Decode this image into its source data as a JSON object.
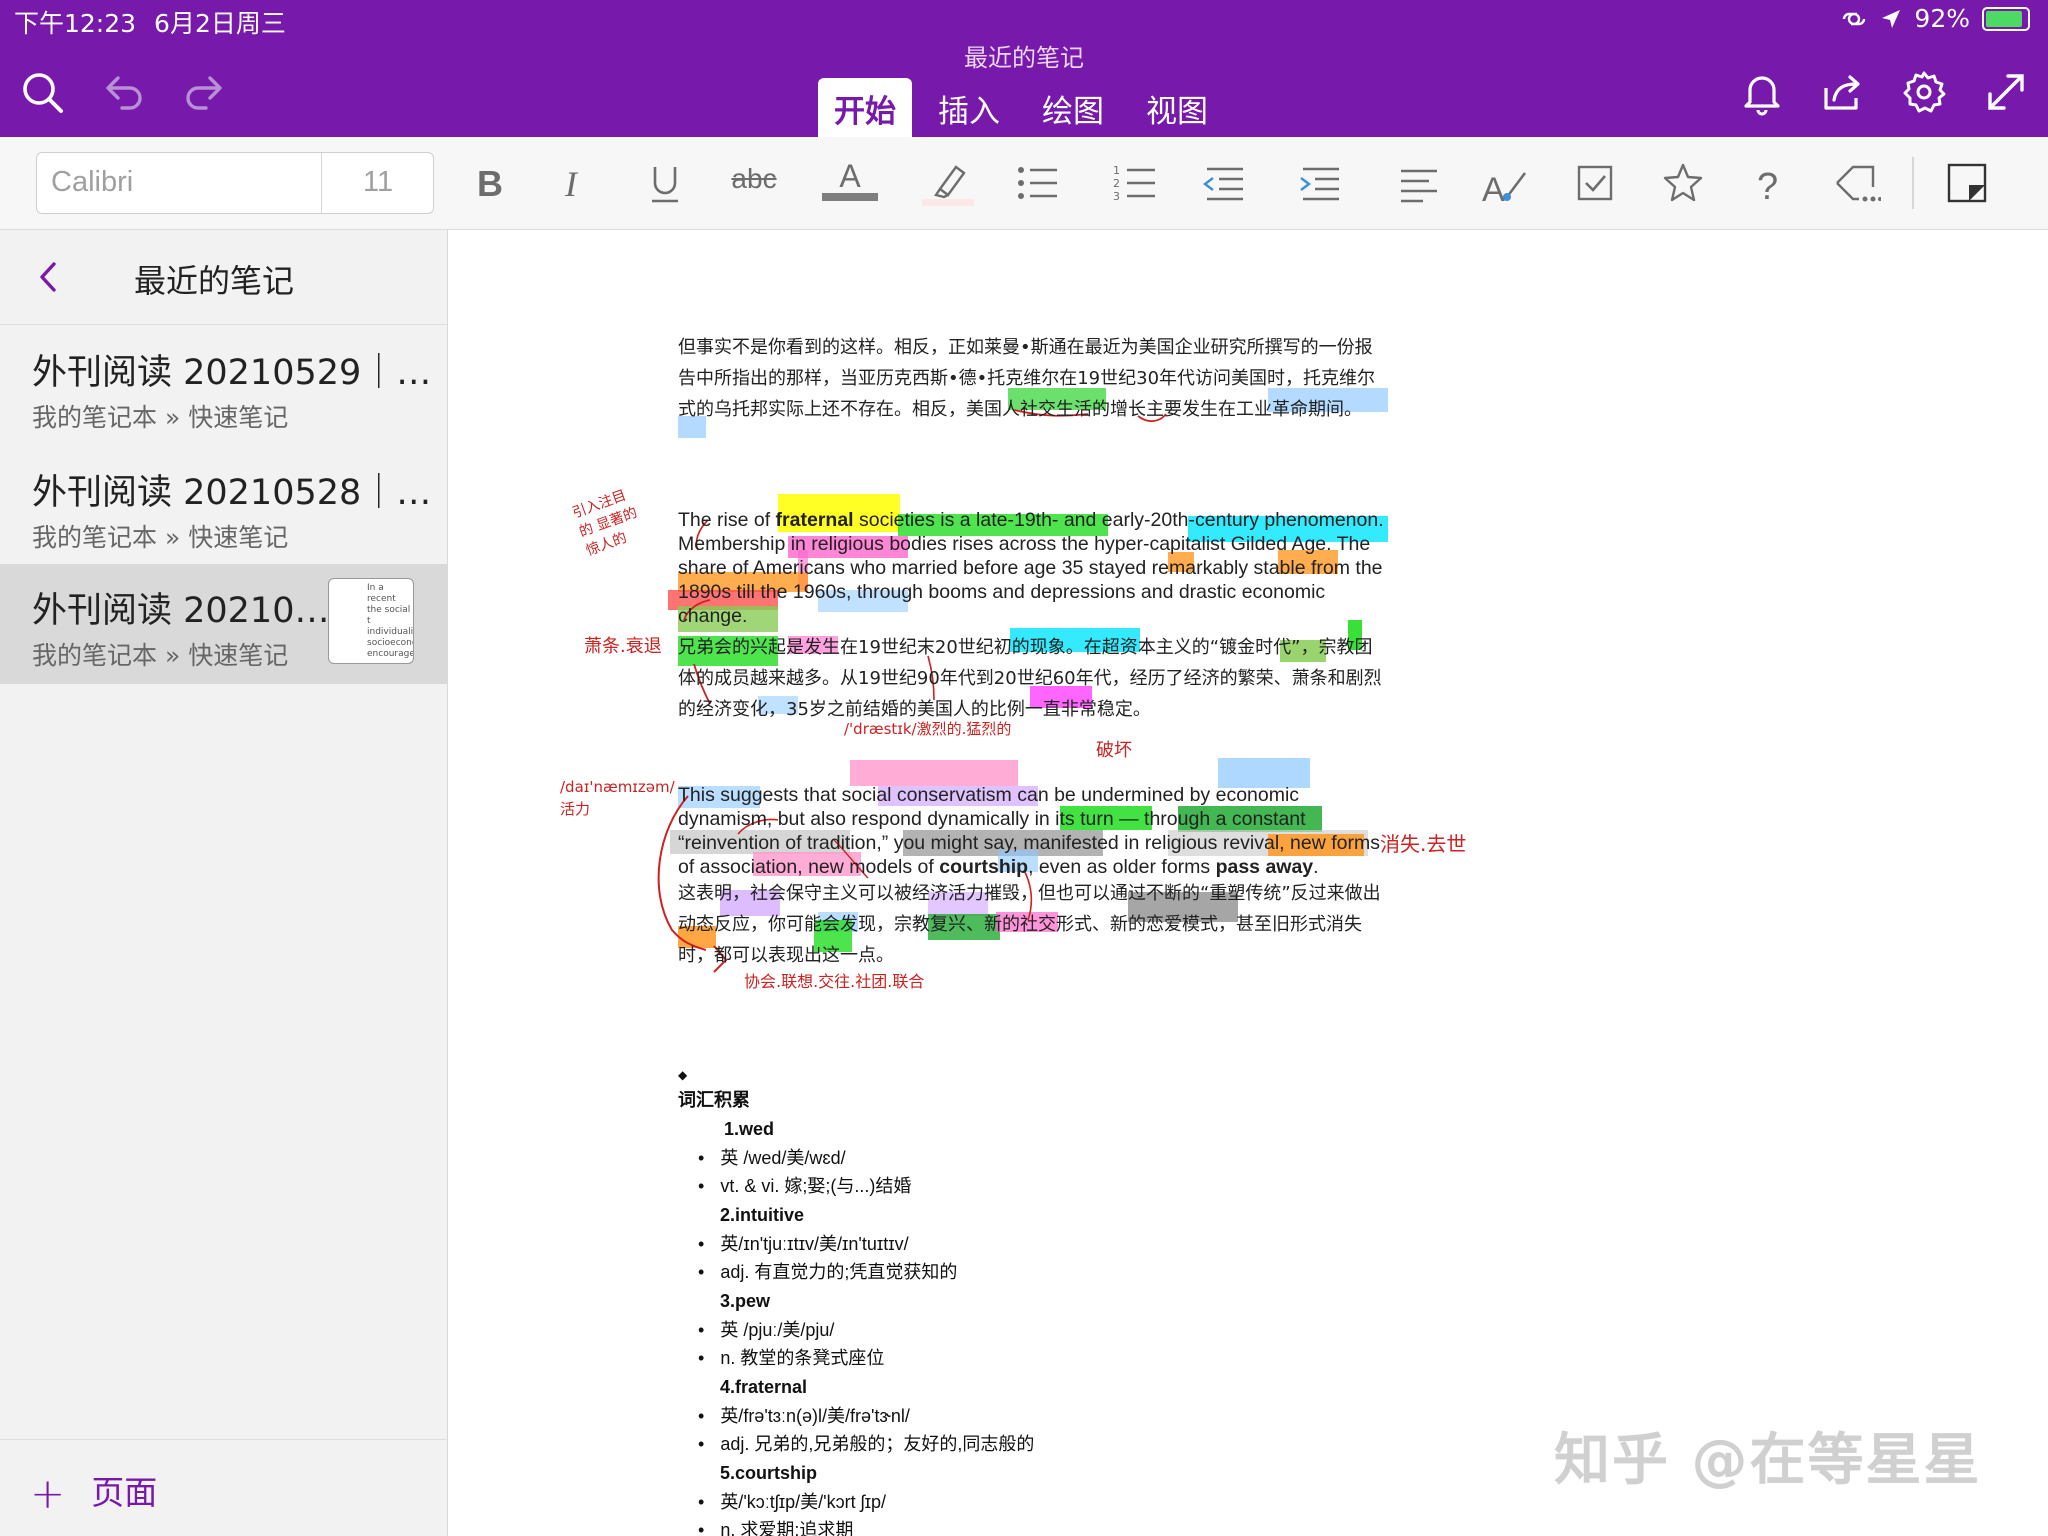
{
  "status_bar": {
    "time": "下午12:23",
    "date": "6月2日周三",
    "battery": "92%"
  },
  "header": {
    "doc_title": "最近的笔记",
    "tabs": [
      {
        "label": "开始",
        "active": true
      },
      {
        "label": "插入",
        "active": false
      },
      {
        "label": "绘图",
        "active": false
      },
      {
        "label": "视图",
        "active": false
      }
    ]
  },
  "toolbar": {
    "font_name": "Calibri",
    "font_size": "11",
    "strikethrough_label": "abc",
    "font_color_label": "A",
    "font_color": "#7f7f7f"
  },
  "sidebar": {
    "title": "最近的笔记",
    "notes": [
      {
        "title": "外刊阅读 20210529｜…",
        "path": "我的笔记本 » 快速笔记"
      },
      {
        "title": "外刊阅读 20210528｜…",
        "path": "我的笔记本 » 快速笔记"
      },
      {
        "title": "外刊阅读 20210…",
        "path": "我的笔记本 » 快速笔记"
      }
    ],
    "thumbnail_text": "In a recent the social t individualis socioecond encourage",
    "add_page": "页面"
  },
  "content": {
    "p1_zh": "但事实不是你看到的这样。相反，正如莱曼•斯通在最近为美国企业研究所撰写的一份报告中所指出的那样，当亚历克西斯•德•托克维尔在19世纪30年代访问美国时，托克维尔式的乌托邦实际上还不存在。相反，美国人社交生活的增长主要发生在工业革命期间。",
    "p2_en_a": "The rise of ",
    "p2_en_b": "fraternal",
    "p2_en_c": " societies is a late-19th- and early-20th-century phenomenon. Membership in religious bodies rises across the hyper-capitalist Gilded Age. The share of Americans who married before age 35 stayed remarkably stable from the 1890s till the 1960s, through booms and depressions and drastic economic change.",
    "p2_zh": "兄弟会的兴起是发生在19世纪末20世纪初的现象。在超资本主义的“镀金时代”，宗教团体的成员越来越多。从19世纪90年代到20世纪60年代，经历了经济的繁荣、萧条和剧烈的经济变化，35岁之前结婚的美国人的比例一直非常稳定。",
    "p3_en_a": "This suggests that social conservatism can be undermined by economic dynamism, but also respond dynamically in its turn — through a constant “reinvention of tradition,” you might say, manifested in religious revival, new forms of association, new models of ",
    "p3_en_b": "courtship",
    "p3_en_c": ", even as older forms ",
    "p3_en_d": "pass away",
    "p3_en_e": ".",
    "p3_zh": "这表明，社会保守主义可以被经济活力摧毁，但也可以通过不断的“重塑传统”反过来做出动态反应，你可能会发现，宗教复兴、新的社交形式、新的恋爱模式，甚至旧形式消失时，都可以表现出这一点。"
  },
  "vocab": {
    "bullet_marker": "◆",
    "heading": "词汇积累",
    "entries": [
      {
        "word": "1.wed",
        "lines": [
          "英 /wed/美/wɛd/",
          "vt. & vi. 嫁;娶;(与...)结婚"
        ]
      },
      {
        "word": "2.intuitive",
        "lines": [
          "英/ɪn'tjuːɪtɪv/美/ɪn'tuɪtɪv/",
          "adj. 有直觉力的;凭直觉获知的"
        ]
      },
      {
        "word": "3.pew",
        "lines": [
          "英 /pjuː/美/pju/",
          "n. 教堂的条凳式座位"
        ]
      },
      {
        "word": "4.fraternal",
        "lines": [
          "英/frə'tɜːn(ə)l/美/frə'tɝnl/",
          "adj. 兄弟的,兄弟般的；友好的,同志般的"
        ]
      },
      {
        "word": "5.courtship",
        "lines": [
          "英/'kɔːtʃɪp/美/'kɔrt ʃɪp/",
          "n. 求爱期;追求期"
        ]
      }
    ]
  },
  "annotations": {
    "a1": "引入注目的 显著的 惊人的",
    "a2": "萧条.衰退",
    "a3": "/'dræstɪk/激烈的.猛烈的",
    "a4": "破坏",
    "a5": "/daɪ'næmɪzəm/ 活力",
    "a6": "消失.去世",
    "a7": "协会.联想.交往.社团.联合"
  },
  "watermark": "知乎 @在等星星"
}
